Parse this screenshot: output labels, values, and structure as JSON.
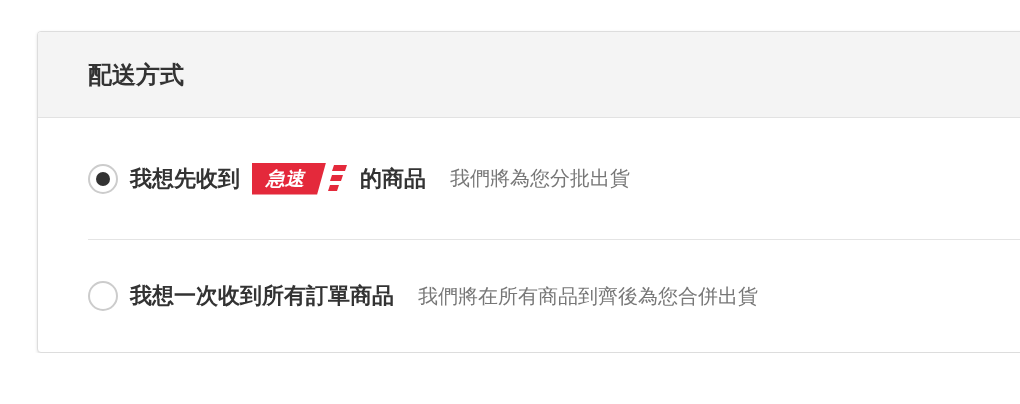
{
  "panel": {
    "title": "配送方式"
  },
  "options": [
    {
      "selected": true,
      "label_before": "我想先收到",
      "badge": "急速",
      "label_after": "的商品",
      "note": "我們將為您分批出貨"
    },
    {
      "selected": false,
      "label_before": "我想一次收到所有訂單商品",
      "note": "我們將在所有商品到齊後為您合併出貨"
    }
  ]
}
